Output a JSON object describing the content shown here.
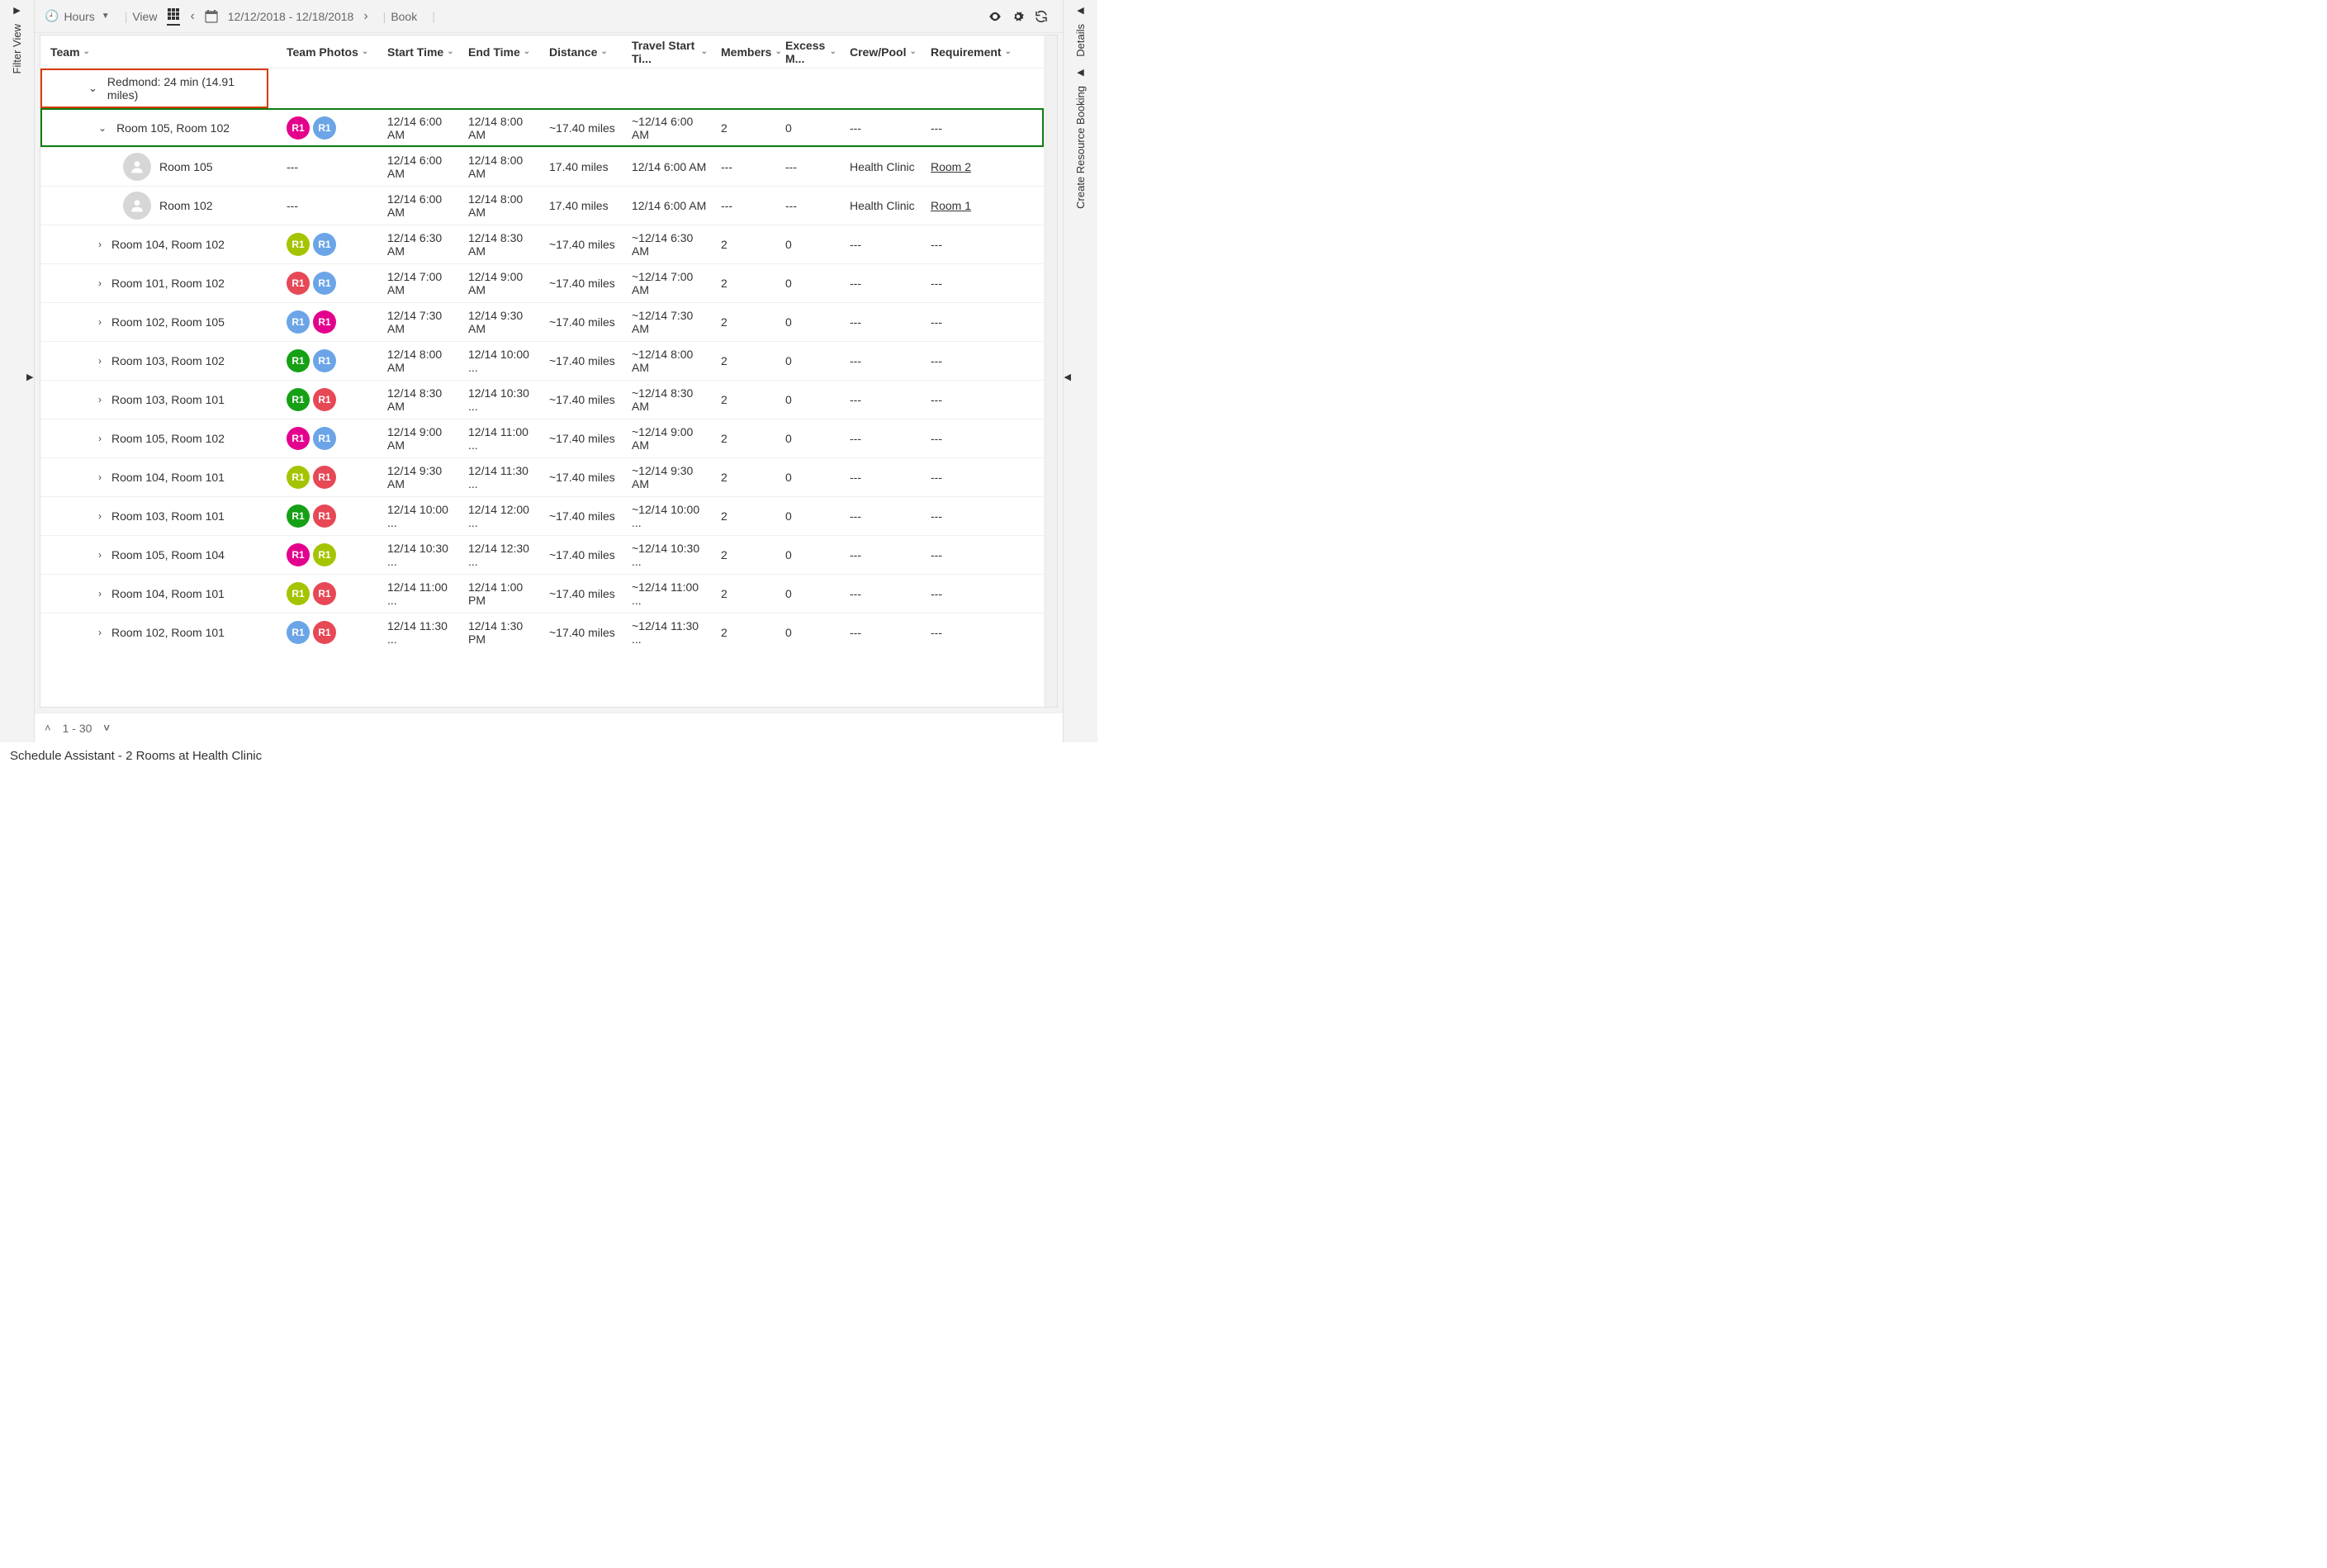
{
  "toolbar": {
    "hours_label": "Hours",
    "view_label": "View",
    "date_range": "12/12/2018 - 12/18/2018",
    "book_label": "Book"
  },
  "rails": {
    "left_label": "Filter View",
    "right_top": "Details",
    "right_bottom": "Create Resource Booking"
  },
  "columns": {
    "team": "Team",
    "photos": "Team Photos",
    "start": "Start Time",
    "end": "End Time",
    "dist": "Distance",
    "travel": "Travel Start Ti...",
    "members": "Members",
    "excess": "Excess M...",
    "crew": "Crew/Pool",
    "req": "Requirement"
  },
  "group_label": "Redmond: 24 min (14.91 miles)",
  "avatar_colors": {
    "pink": "#e3008c",
    "blue": "#6ba5e7",
    "olive": "#a4c400",
    "red": "#e74856",
    "green": "#16a016"
  },
  "rows": [
    {
      "type": "team",
      "expanded": true,
      "highlight": "green",
      "name": "Room 105, Room 102",
      "av": [
        "pink",
        "blue"
      ],
      "start": "12/14 6:00 AM",
      "end": "12/14 8:00 AM",
      "dist": "~17.40 miles",
      "travel": "~12/14 6:00 AM",
      "members": "2",
      "excess": "0",
      "crew": "---",
      "req": "---"
    },
    {
      "type": "child",
      "name": "Room 105",
      "av": "person",
      "photos": "---",
      "start": "12/14 6:00 AM",
      "end": "12/14 8:00 AM",
      "dist": "17.40 miles",
      "travel": "12/14 6:00 AM",
      "members": "---",
      "excess": "---",
      "crew": "Health Clinic",
      "req": "Room 2",
      "reqlink": true
    },
    {
      "type": "child",
      "name": "Room 102",
      "av": "person",
      "photos": "---",
      "start": "12/14 6:00 AM",
      "end": "12/14 8:00 AM",
      "dist": "17.40 miles",
      "travel": "12/14 6:00 AM",
      "members": "---",
      "excess": "---",
      "crew": "Health Clinic",
      "req": "Room 1",
      "reqlink": true
    },
    {
      "type": "team",
      "name": "Room 104, Room 102",
      "av": [
        "olive",
        "blue"
      ],
      "start": "12/14 6:30 AM",
      "end": "12/14 8:30 AM",
      "dist": "~17.40 miles",
      "travel": "~12/14 6:30 AM",
      "members": "2",
      "excess": "0",
      "crew": "---",
      "req": "---"
    },
    {
      "type": "team",
      "name": "Room 101, Room 102",
      "av": [
        "red",
        "blue"
      ],
      "start": "12/14 7:00 AM",
      "end": "12/14 9:00 AM",
      "dist": "~17.40 miles",
      "travel": "~12/14 7:00 AM",
      "members": "2",
      "excess": "0",
      "crew": "---",
      "req": "---"
    },
    {
      "type": "team",
      "name": "Room 102, Room 105",
      "av": [
        "blue",
        "pink"
      ],
      "start": "12/14 7:30 AM",
      "end": "12/14 9:30 AM",
      "dist": "~17.40 miles",
      "travel": "~12/14 7:30 AM",
      "members": "2",
      "excess": "0",
      "crew": "---",
      "req": "---"
    },
    {
      "type": "team",
      "name": "Room 103, Room 102",
      "av": [
        "green",
        "blue"
      ],
      "start": "12/14 8:00 AM",
      "end": "12/14 10:00 ...",
      "dist": "~17.40 miles",
      "travel": "~12/14 8:00 AM",
      "members": "2",
      "excess": "0",
      "crew": "---",
      "req": "---"
    },
    {
      "type": "team",
      "name": "Room 103, Room 101",
      "av": [
        "green",
        "red"
      ],
      "start": "12/14 8:30 AM",
      "end": "12/14 10:30 ...",
      "dist": "~17.40 miles",
      "travel": "~12/14 8:30 AM",
      "members": "2",
      "excess": "0",
      "crew": "---",
      "req": "---"
    },
    {
      "type": "team",
      "name": "Room 105, Room 102",
      "av": [
        "pink",
        "blue"
      ],
      "start": "12/14 9:00 AM",
      "end": "12/14 11:00 ...",
      "dist": "~17.40 miles",
      "travel": "~12/14 9:00 AM",
      "members": "2",
      "excess": "0",
      "crew": "---",
      "req": "---"
    },
    {
      "type": "team",
      "name": "Room 104, Room 101",
      "av": [
        "olive",
        "red"
      ],
      "start": "12/14 9:30 AM",
      "end": "12/14 11:30 ...",
      "dist": "~17.40 miles",
      "travel": "~12/14 9:30 AM",
      "members": "2",
      "excess": "0",
      "crew": "---",
      "req": "---"
    },
    {
      "type": "team",
      "name": "Room 103, Room 101",
      "av": [
        "green",
        "red"
      ],
      "start": "12/14 10:00 ...",
      "end": "12/14 12:00 ...",
      "dist": "~17.40 miles",
      "travel": "~12/14 10:00 ...",
      "members": "2",
      "excess": "0",
      "crew": "---",
      "req": "---"
    },
    {
      "type": "team",
      "name": "Room 105, Room 104",
      "av": [
        "pink",
        "olive"
      ],
      "start": "12/14 10:30 ...",
      "end": "12/14 12:30 ...",
      "dist": "~17.40 miles",
      "travel": "~12/14 10:30 ...",
      "members": "2",
      "excess": "0",
      "crew": "---",
      "req": "---"
    },
    {
      "type": "team",
      "name": "Room 104, Room 101",
      "av": [
        "olive",
        "red"
      ],
      "start": "12/14 11:00 ...",
      "end": "12/14 1:00 PM",
      "dist": "~17.40 miles",
      "travel": "~12/14 11:00 ...",
      "members": "2",
      "excess": "0",
      "crew": "---",
      "req": "---"
    },
    {
      "type": "team",
      "name": "Room 102, Room 101",
      "av": [
        "blue",
        "red"
      ],
      "start": "12/14 11:30 ...",
      "end": "12/14 1:30 PM",
      "dist": "~17.40 miles",
      "travel": "~12/14 11:30 ...",
      "members": "2",
      "excess": "0",
      "crew": "---",
      "req": "---"
    }
  ],
  "avatar_text": "R1",
  "pager": {
    "range": "1 - 30"
  },
  "status": "Schedule Assistant - 2 Rooms at Health Clinic"
}
